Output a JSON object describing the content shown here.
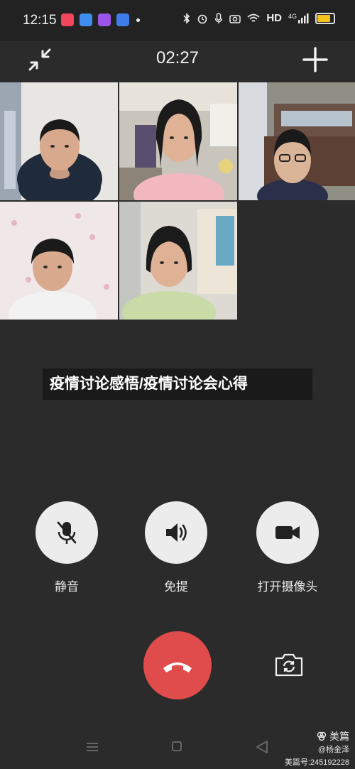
{
  "status_bar": {
    "time": "12:15",
    "network_label": "HD",
    "signal_label": "4G",
    "icons": [
      "bluetooth-icon",
      "alarm-icon",
      "mic-icon",
      "camera-icon",
      "wifi-icon",
      "signal-icon",
      "battery-icon"
    ],
    "app_icons": [
      {
        "name": "app-icon-red",
        "color": "#f0475c"
      },
      {
        "name": "app-icon-blue",
        "color": "#3d8ef0"
      },
      {
        "name": "app-icon-purple",
        "color": "#9a55e8"
      },
      {
        "name": "app-icon-cloud",
        "color": "#3f7ee8"
      }
    ]
  },
  "call": {
    "timer": "02:27"
  },
  "participants": [
    {
      "name": "participant-1",
      "bg": "#e8e6e2",
      "shirt": "#1f2a3a"
    },
    {
      "name": "participant-2",
      "bg": "#c9c5bd",
      "shirt": "#f2b8c0"
    },
    {
      "name": "participant-3",
      "bg": "#8f8f86",
      "shirt": "#2c2f4a"
    },
    {
      "name": "participant-4",
      "bg": "#efe7e8",
      "shirt": "#f2f2f2"
    },
    {
      "name": "participant-5",
      "bg": "#dcdad2",
      "shirt": "#c9dba6"
    }
  ],
  "overlay_text": "疫情讨论感悟/疫情讨论会心得",
  "controls": {
    "mute_label": "静音",
    "speaker_label": "免提",
    "camera_label": "打开摄像头"
  },
  "colors": {
    "background": "#2b2b2b",
    "hangup": "#e04b4b",
    "control_circle": "#ececec"
  },
  "watermark": {
    "brand": "美篇",
    "user": "@杨金泽",
    "id": "美篇号:245192228"
  }
}
